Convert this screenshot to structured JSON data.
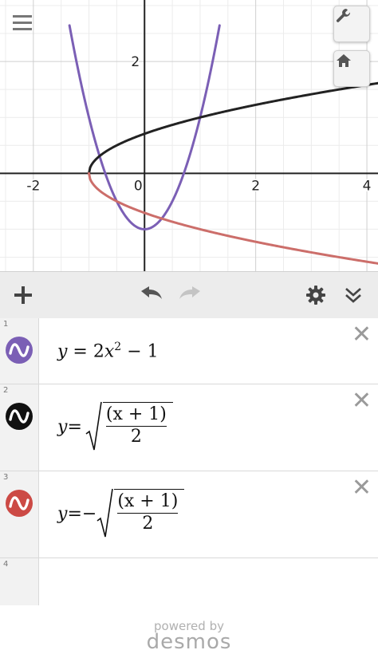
{
  "graph": {
    "x_ticks": [
      "-2",
      "0",
      "2",
      "4"
    ],
    "y_ticks": [
      "2"
    ],
    "colors": {
      "purple": "#7b5fb5",
      "black": "#222222",
      "red": "#cc6e6a",
      "grid_major": "#cfcfcf",
      "grid_minor": "#ececec",
      "axis": "#222222"
    },
    "buttons": {
      "settings_icon": "wrench-icon",
      "home_icon": "home-icon",
      "menu_icon": "hamburger-icon"
    }
  },
  "chart_data": {
    "type": "line",
    "xlim": [
      -2.6,
      4.2
    ],
    "ylim": [
      -1.75,
      3.1
    ],
    "grid": true,
    "series": [
      {
        "color": "#7b5fb5",
        "x": [
          -1.25,
          -1.0,
          -0.75,
          -0.5,
          -0.25,
          0.0,
          0.25,
          0.5,
          0.75,
          1.0,
          1.3
        ],
        "y": [
          2.125,
          1.0,
          0.125,
          -0.5,
          -0.875,
          -1.0,
          -0.875,
          -0.5,
          0.125,
          1.0,
          2.38
        ]
      },
      {
        "color": "#222222",
        "x": [
          -1.0,
          -0.9,
          -0.75,
          -0.5,
          0.0,
          1.0,
          2.0,
          3.0,
          4.2
        ],
        "y": [
          0.0,
          0.224,
          0.354,
          0.5,
          0.707,
          1.0,
          1.225,
          1.414,
          1.612
        ]
      },
      {
        "color": "#cc6e6a",
        "x": [
          -1.0,
          -0.9,
          -0.75,
          -0.5,
          0.0,
          1.0,
          2.0,
          3.0,
          4.2
        ],
        "y": [
          0.0,
          -0.224,
          -0.354,
          -0.5,
          -0.707,
          -1.0,
          -1.225,
          -1.414,
          -1.612
        ]
      }
    ]
  },
  "toolbar": {
    "add_icon": "plus-icon",
    "undo_icon": "undo-icon",
    "redo_icon": "redo-icon",
    "settings_icon": "gear-icon",
    "collapse_icon": "double-chevron-down-icon"
  },
  "expressions": [
    {
      "num": "1",
      "color": "#7b5fb5",
      "lhs": "y",
      "eq": " = 2",
      "var": "x",
      "exp": "2",
      "tail": " − 1"
    },
    {
      "num": "2",
      "color": "#111111",
      "lhs": "y",
      "eq": " =",
      "sign": "",
      "numer": "(x + 1)",
      "denom": "2"
    },
    {
      "num": "3",
      "color": "#cc4a45",
      "lhs": "y",
      "eq": " = ",
      "sign": "−",
      "numer": "(x + 1)",
      "denom": "2"
    },
    {
      "num": "4"
    }
  ],
  "footer": {
    "powered": "powered by",
    "brand": "desmos"
  }
}
